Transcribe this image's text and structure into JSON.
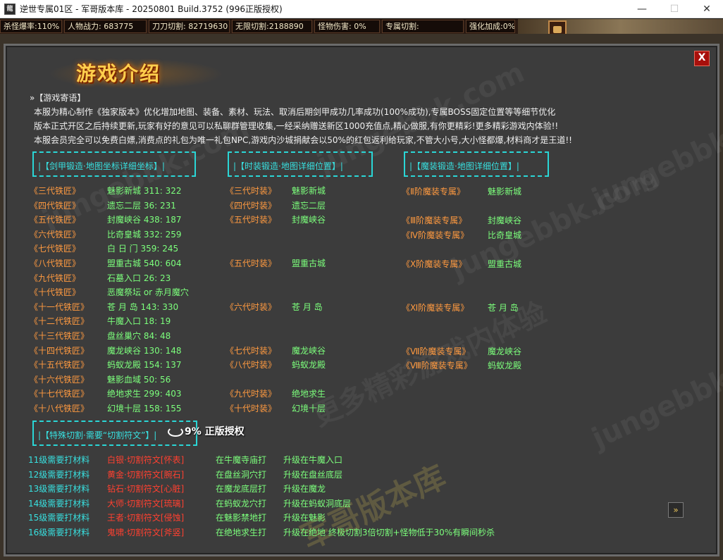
{
  "window": {
    "title": "逆世专属01区 - 军哥版本库 - 20250801 Build.3752 (996正版授权)",
    "minimize": "—",
    "maximize": "☐",
    "close": "✕"
  },
  "stats": [
    {
      "label": "杀怪爆率:110%"
    },
    {
      "label": "人物战力: 683775"
    },
    {
      "label": "刀刀切割: 82719630"
    },
    {
      "label": "无限切割:2188890"
    },
    {
      "label": "怪物伤害: 0%"
    },
    {
      "label": "专属切割:"
    },
    {
      "label": "强化加成:0%"
    }
  ],
  "dialog": {
    "title": "游戏介绍",
    "close_label": "X",
    "section_label": "»【游戏寄语】",
    "intro": [
      "本服为精心制作《独家版本》优化增加地图、装备、素材、玩法、取消后期剑甲成功几率成功(100%成功),专属BOSS固定位置等等细节优化",
      "版本正式开区之后持续更新,玩家有好的意见可以私聊群管理收集,一经采纳赠送新区1000充值点,精心做服,有你更精彩!更多精彩游戏内体验!!",
      "本服会员完全可以免费白嫖,消费点的礼包为唯一礼包NPC,游戏内沙城捐献会以50%的红包返利给玩家,不管大小号,大小怪都爆,材料商才是王道!!"
    ],
    "headers": {
      "col1": "|【剑甲锻造·地图坐标详细坐标】|",
      "col2": "|【时装锻造·地图详细位置】|",
      "col3": "|【魔装锻造·地图详细位置】|",
      "special": "|【特殊切割·需要“切割符文”】|"
    },
    "col1": [
      {
        "name": "《三代铁匠》",
        "loc": "魅影新城 311: 322"
      },
      {
        "name": "《四代铁匠》",
        "loc": "遗忘二层 36: 231"
      },
      {
        "name": "《五代铁匠》",
        "loc": "封魔峡谷 438: 187"
      },
      {
        "name": "《六代铁匠》",
        "loc": "比奇皇城 332: 259"
      },
      {
        "name": "《七代铁匠》",
        "loc": "白 日 门 359: 245"
      },
      {
        "name": "《八代铁匠》",
        "loc": "盟重古城 540: 604"
      },
      {
        "name": "《九代铁匠》",
        "loc": "石墓入口 26: 23"
      },
      {
        "name": "《十代铁匠》",
        "loc": "恶魔祭坛 or 赤月魔穴"
      },
      {
        "name": "《十一代铁匠》",
        "loc": "苍 月 岛 143: 330"
      },
      {
        "name": "《十二代铁匠》",
        "loc": "牛魔入口 18: 19"
      },
      {
        "name": "《十三代铁匠》",
        "loc": "盘丝巢穴 84: 48"
      },
      {
        "name": "《十四代铁匠》",
        "loc": "魔龙峡谷 130: 148"
      },
      {
        "name": "《十五代铁匠》",
        "loc": "蚂蚁龙殿 154: 137"
      },
      {
        "name": "《十六代铁匠》",
        "loc": "魅影血域 50: 56"
      },
      {
        "name": "《十七代铁匠》",
        "loc": "绝地求生 299: 403"
      },
      {
        "name": "《十八代铁匠》",
        "loc": "幻境十层 158: 155"
      }
    ],
    "col2": [
      {
        "row": 0,
        "name": "《三代时装》",
        "loc": "魅影新城"
      },
      {
        "row": 1,
        "name": "《四代时装》",
        "loc": "遗忘二层"
      },
      {
        "row": 2,
        "name": "《五代时装》",
        "loc": "封魔峡谷"
      },
      {
        "row": 5,
        "name": "《五代时装》",
        "loc": "盟重古城"
      },
      {
        "row": 8,
        "name": "《六代时装》",
        "loc": "苍 月 岛"
      },
      {
        "row": 11,
        "name": "《七代时装》",
        "loc": "魔龙峡谷"
      },
      {
        "row": 12,
        "name": "《八代时装》",
        "loc": "蚂蚁龙殿"
      },
      {
        "row": 14,
        "name": "《九代时装》",
        "loc": "绝地求生"
      },
      {
        "row": 15,
        "name": "《十代时装》",
        "loc": "幻境十层"
      }
    ],
    "col3": [
      {
        "row": 0,
        "name": "《Ⅱ阶魔装专属》",
        "loc": "魅影新城"
      },
      {
        "row": 2,
        "name": "《Ⅲ阶魔装专属》",
        "loc": "封魔峡谷"
      },
      {
        "row": 3,
        "name": "《Ⅳ阶魔装专属》",
        "loc": "比奇皇城"
      },
      {
        "row": 5,
        "name": "《Ⅹ阶魔装专属》",
        "loc": "盟重古城"
      },
      {
        "row": 8,
        "name": "《Ⅺ阶魔装专属》",
        "loc": "苍 月 岛"
      },
      {
        "row": 11,
        "name": "《Ⅶ阶魔装专属》",
        "loc": "魔龙峡谷"
      },
      {
        "row": 12,
        "name": "《Ⅷ阶魔装专属》",
        "loc": "蚂蚁龙殿"
      }
    ],
    "special": [
      {
        "level": "11级需要打材料",
        "item": "白银·切割符文[怀表]",
        "where": "在牛魔寺庙打",
        "up": "升级在牛魔入口"
      },
      {
        "level": "12级需要打材料",
        "item": "黄金·切割符文[腕石]",
        "where": "在盘丝洞穴打",
        "up": "升级在盘丝底层"
      },
      {
        "level": "13级需要打材料",
        "item": "钻石·切割符文[心脏]",
        "where": "在魔龙底层打",
        "up": "升级在魔龙"
      },
      {
        "level": "14级需要打材料",
        "item": "大师·切割符文[琉璃]",
        "where": "在蚂蚁龙穴打",
        "up": "升级在蚂蚁洞底层"
      },
      {
        "level": "15级需要打材料",
        "item": "王者·切割符文[侵蚀]",
        "where": "在魅影禁地打",
        "up": "升级在魅影"
      },
      {
        "level": "16级需要打材料",
        "item": "鬼啸·切割符文[斧竖]",
        "where": "在绝地求生打",
        "up": "升级在绝地 终极切割3倍切割+怪物低于30%有瞬间秒杀"
      }
    ],
    "overlay_text": "9% 正版授权",
    "next_label": "»"
  },
  "watermarks": [
    "jungebbk.com",
    "更多精彩游戏内体验",
    "军哥版本库"
  ]
}
